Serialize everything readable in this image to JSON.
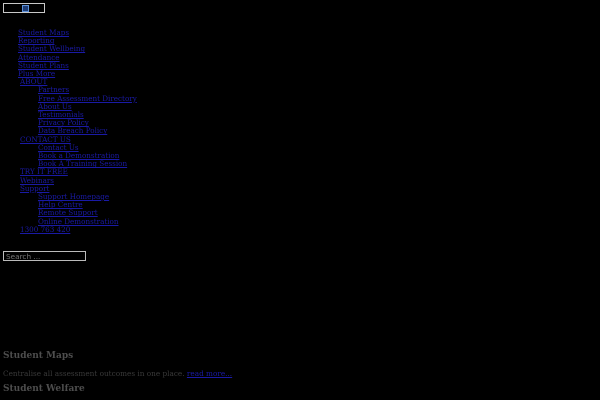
{
  "menu_toggle": {
    "icon": "menu-icon"
  },
  "nav": {
    "product_items": [
      "Student Maps",
      "Reporting",
      "Student Wellbeing",
      "Attendance",
      "Student Plans",
      "Plus More"
    ],
    "about": {
      "label": "ABOUT",
      "items": [
        "Partners",
        "Free Assessment Directory",
        "About Us",
        "Testimonials",
        "Privacy Policy",
        "Data Breach Policy"
      ]
    },
    "contact": {
      "label": "CONTACT US",
      "items": [
        "Contact Us",
        "Book a Demonstration",
        "Book A Training Session"
      ]
    },
    "try_free": "TRY IT FREE",
    "webinars": "Webinars",
    "support": {
      "label": "Support",
      "items": [
        "Support Homepage",
        "Help Centre",
        "Remote Support",
        "Online Demonstration"
      ]
    },
    "phone": "1300 763 420"
  },
  "search": {
    "placeholder": "Search ..."
  },
  "sections": [
    {
      "title": "Student Maps",
      "description": "Centralise all assessment outcomes in one place.",
      "link": "read more..."
    },
    {
      "title": "Student Welfare"
    }
  ],
  "colors": {
    "background": "#000000",
    "link": "#1a1aa6",
    "heading": "#4d4d4d"
  }
}
